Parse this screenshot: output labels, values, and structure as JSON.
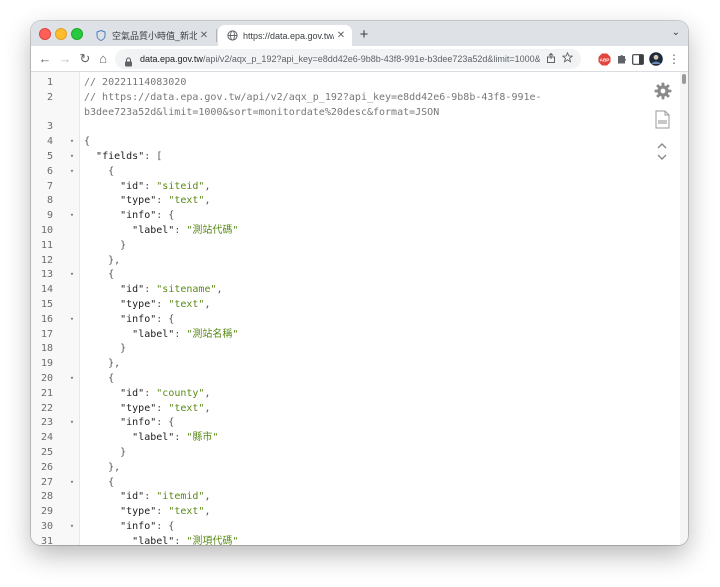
{
  "window": {
    "tabs": [
      {
        "title": "空氣品質小時值_新北市_新店站",
        "active": false
      },
      {
        "title": "https://data.epa.gov.tw/api/v2/",
        "active": true
      }
    ],
    "new_tab_label": "+",
    "tab_menu_label": "⌄"
  },
  "toolbar": {
    "back_label": "←",
    "forward_label": "→",
    "reload_label": "↻",
    "home_label": "⌂",
    "url_host": "data.epa.gov.tw",
    "url_path": "/api/v2/aqx_p_192?api_key=e8dd42e6-9b8b-43f8-991e-b3dee723a52d&limit=1000&sort=monitordate%20desc&format=JSON",
    "abp_label": "ABP",
    "menu_label": "⋮"
  },
  "colors": {
    "comment": "#777777",
    "string": "#5a8a16",
    "key": "#202124",
    "tabbar": "#dee1e6"
  },
  "icons": [
    "shield-icon",
    "lock-icon",
    "share-icon",
    "star-icon",
    "puzzle-icon",
    "side-panel-icon",
    "avatar-icon",
    "gear-icon",
    "raw-file-icon",
    "chevron-up-icon",
    "chevron-down-icon"
  ],
  "editor": {
    "lines": [
      {
        "n": "1",
        "fold": false,
        "text": "// 20221114083020"
      },
      {
        "n": "2",
        "fold": false,
        "text": "// https://data.epa.gov.tw/api/v2/aqx_p_192?api_key=e8dd42e6-9b8b-43f8-991e-"
      },
      {
        "n": "",
        "fold": false,
        "text": "b3dee723a52d&limit=1000&sort=monitordate%20desc&format=JSON"
      },
      {
        "n": "3",
        "fold": false,
        "text": ""
      },
      {
        "n": "4",
        "fold": true,
        "text": "{"
      },
      {
        "n": "5",
        "fold": true,
        "text": "  \"fields\": ["
      },
      {
        "n": "6",
        "fold": true,
        "text": "    {"
      },
      {
        "n": "7",
        "fold": false,
        "text": "      \"id\": \"siteid\","
      },
      {
        "n": "8",
        "fold": false,
        "text": "      \"type\": \"text\","
      },
      {
        "n": "9",
        "fold": true,
        "text": "      \"info\": {"
      },
      {
        "n": "10",
        "fold": false,
        "text": "        \"label\": \"測站代碼\""
      },
      {
        "n": "11",
        "fold": false,
        "text": "      }"
      },
      {
        "n": "12",
        "fold": false,
        "text": "    },"
      },
      {
        "n": "13",
        "fold": true,
        "text": "    {"
      },
      {
        "n": "14",
        "fold": false,
        "text": "      \"id\": \"sitename\","
      },
      {
        "n": "15",
        "fold": false,
        "text": "      \"type\": \"text\","
      },
      {
        "n": "16",
        "fold": true,
        "text": "      \"info\": {"
      },
      {
        "n": "17",
        "fold": false,
        "text": "        \"label\": \"測站名稱\""
      },
      {
        "n": "18",
        "fold": false,
        "text": "      }"
      },
      {
        "n": "19",
        "fold": false,
        "text": "    },"
      },
      {
        "n": "20",
        "fold": true,
        "text": "    {"
      },
      {
        "n": "21",
        "fold": false,
        "text": "      \"id\": \"county\","
      },
      {
        "n": "22",
        "fold": false,
        "text": "      \"type\": \"text\","
      },
      {
        "n": "23",
        "fold": true,
        "text": "      \"info\": {"
      },
      {
        "n": "24",
        "fold": false,
        "text": "        \"label\": \"縣市\""
      },
      {
        "n": "25",
        "fold": false,
        "text": "      }"
      },
      {
        "n": "26",
        "fold": false,
        "text": "    },"
      },
      {
        "n": "27",
        "fold": true,
        "text": "    {"
      },
      {
        "n": "28",
        "fold": false,
        "text": "      \"id\": \"itemid\","
      },
      {
        "n": "29",
        "fold": false,
        "text": "      \"type\": \"text\","
      },
      {
        "n": "30",
        "fold": true,
        "text": "      \"info\": {"
      },
      {
        "n": "31",
        "fold": false,
        "text": "        \"label\": \"測項代碼\""
      }
    ]
  }
}
